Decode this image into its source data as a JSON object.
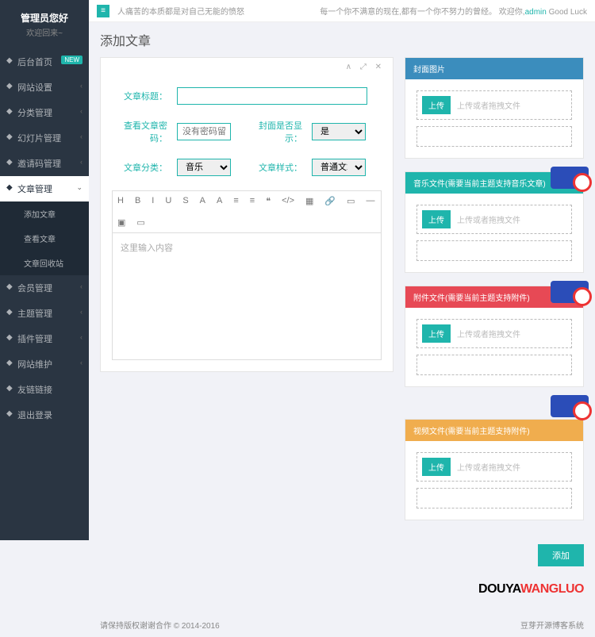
{
  "sidebar": {
    "title": "管理员您好",
    "subtitle": "欢迎回来~",
    "items": [
      {
        "label": "后台首页",
        "badge": "NEW"
      },
      {
        "label": "网站设置",
        "chev": true
      },
      {
        "label": "分类管理",
        "chev": true
      },
      {
        "label": "幻灯片管理",
        "chev": true
      },
      {
        "label": "邀请码管理",
        "chev": true
      },
      {
        "label": "文章管理",
        "chev": true,
        "active": true
      },
      {
        "label": "添加文章",
        "sub": true
      },
      {
        "label": "查看文章",
        "sub": true
      },
      {
        "label": "文章回收站",
        "sub": true
      },
      {
        "label": "会员管理",
        "chev": true
      },
      {
        "label": "主题管理",
        "chev": true
      },
      {
        "label": "插件管理",
        "chev": true
      },
      {
        "label": "网站维护",
        "chev": true
      },
      {
        "label": "友链链接"
      },
      {
        "label": "退出登录"
      }
    ]
  },
  "topbar": {
    "quote": "人痛苦的本质都是对自己无能的愤怒",
    "right_pre": "每一个你不满意的现在,都有一个你不努力的曾经。 欢迎你,",
    "user": "admin",
    "right_post": "  Good Luck"
  },
  "page_title": "添加文章",
  "form": {
    "title_label": "文章标题：",
    "pwd_label": "查看文章密码：",
    "pwd_placeholder": "没有密码留空",
    "cover_show_label": "封面是否显示：",
    "cover_show_value": "是",
    "cat_label": "文章分类：",
    "cat_value": "音乐",
    "style_label": "文章样式：",
    "style_value": "普通文章",
    "editor_placeholder": "这里输入内容"
  },
  "toolbar": [
    "H",
    "B",
    "I",
    "U",
    "S",
    "A",
    "A",
    "≡",
    "≡",
    "❝",
    "</>",
    "▦",
    "🔗",
    "▭",
    "—",
    "▣",
    "▭"
  ],
  "panels": {
    "cover": {
      "title": "封面图片",
      "btn": "上传",
      "hint": "上传或者拖拽文件"
    },
    "music": {
      "title": "音乐文件(需要当前主题支持音乐文章)",
      "btn": "上传",
      "hint": "上传或者拖拽文件"
    },
    "attach": {
      "title": "附件文件(需要当前主题支持附件)",
      "btn": "上传",
      "hint": "上传或者拖拽文件"
    },
    "video": {
      "title": "视频文件(需要当前主题支持附件)",
      "btn": "上传",
      "hint": "上传或者拖拽文件"
    }
  },
  "submit": "添加",
  "brand": {
    "d": "DOUYA",
    "w": "WANGLUO"
  },
  "footer": {
    "left": "请保持版权谢谢合作 © 2014-2016",
    "right": "豆芽开源博客系统"
  }
}
